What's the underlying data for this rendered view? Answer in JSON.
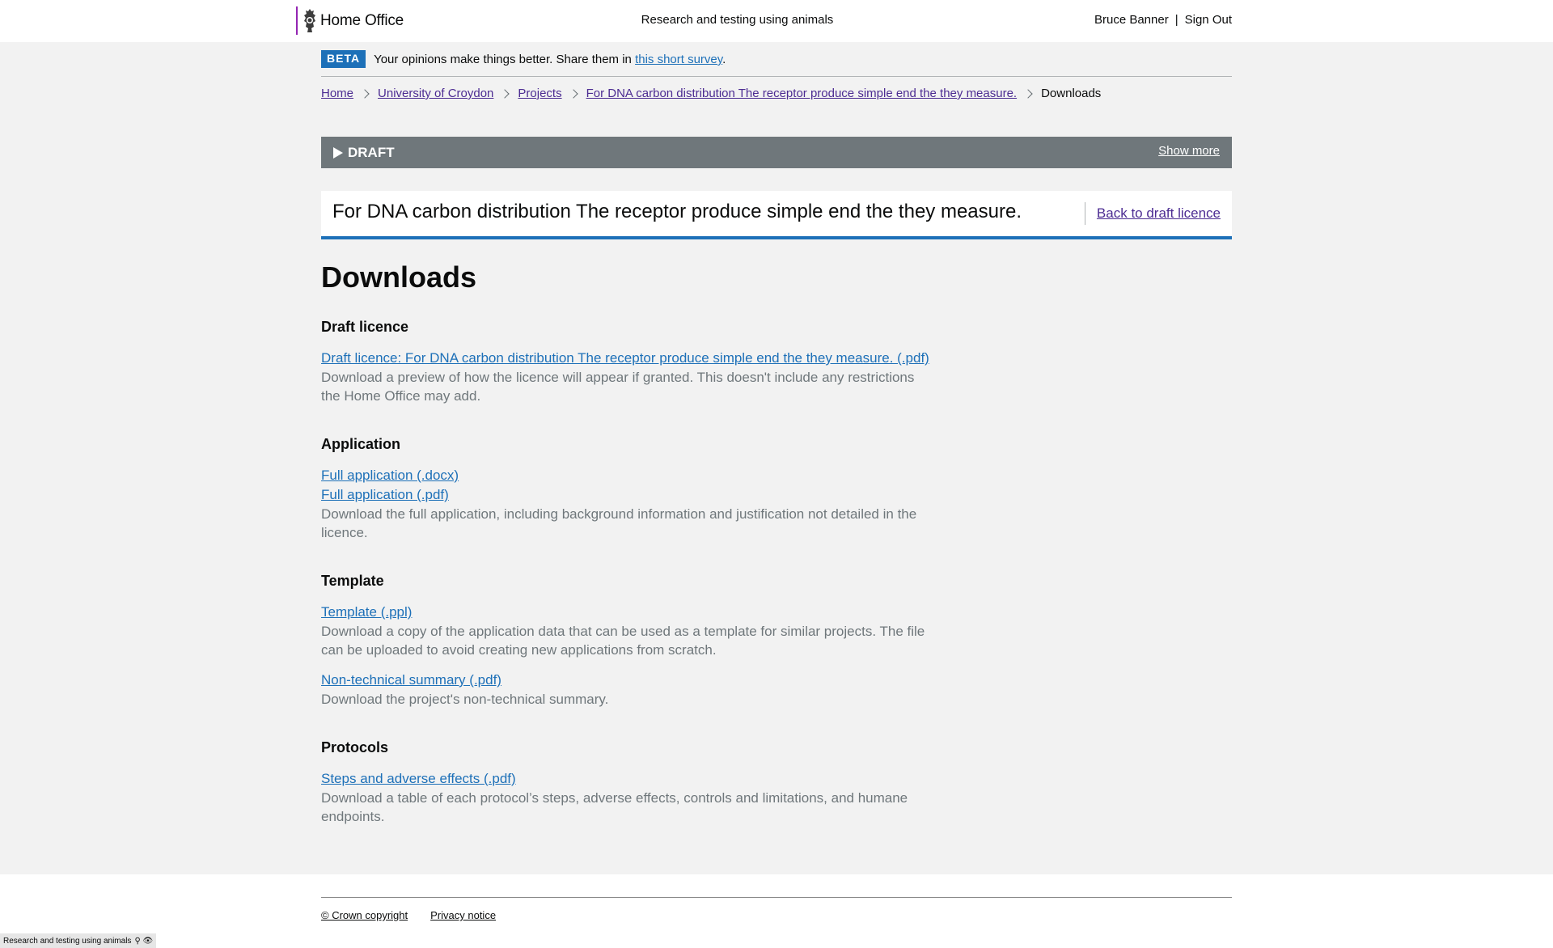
{
  "header": {
    "logo_text": "Home Office",
    "service_name": "Research and testing using animals",
    "user_name": "Bruce Banner",
    "separator": "|",
    "sign_out": "Sign Out"
  },
  "beta": {
    "tag": "BETA",
    "text": "Your opinions make things better. Share them in",
    "link": "this short survey",
    "end": "."
  },
  "breadcrumbs": {
    "home": "Home",
    "establishment": "University of Croydon",
    "projects": "Projects",
    "project": "For DNA carbon distribution The receptor produce simple end the they measure.",
    "current": "Downloads"
  },
  "draft_bar": {
    "label": "DRAFT",
    "show_more": "Show more"
  },
  "title_panel": {
    "title": "For DNA carbon distribution The receptor produce simple end the they measure.",
    "back_link": "Back to draft licence"
  },
  "main": {
    "heading": "Downloads",
    "draft_licence": {
      "heading": "Draft licence",
      "link": "Draft licence: For DNA carbon distribution The receptor produce simple end the they measure. (.pdf)",
      "desc": "Download a preview of how the licence will appear if granted. This doesn't include any restrictions the Home Office may add."
    },
    "application": {
      "heading": "Application",
      "link_docx": "Full application (.docx)",
      "link_pdf": "Full application (.pdf)",
      "desc": "Download the full application, including background information and justification not detailed in the licence."
    },
    "template": {
      "heading": "Template",
      "link": "Template (.ppl)",
      "desc": "Download a copy of the application data that can be used as a template for similar projects. The file can be uploaded to avoid creating new applications from scratch.",
      "nts_link": "Non-technical summary (.pdf)",
      "nts_desc": "Download the project's non-technical summary."
    },
    "protocols": {
      "heading": "Protocols",
      "link": "Steps and adverse effects (.pdf)",
      "desc": "Download a table of each protocol’s steps, adverse effects, controls and limitations, and humane endpoints."
    }
  },
  "footer": {
    "copyright": "© Crown copyright",
    "privacy": "Privacy notice"
  },
  "env_badge": {
    "text": "Research and testing using animals",
    "icons": "⚲ 👁"
  },
  "colors": {
    "link": "#1d70b8",
    "visited_link": "#4c2c92",
    "draft_bar": "#6f777b",
    "beta_tag": "#1d70b8"
  }
}
